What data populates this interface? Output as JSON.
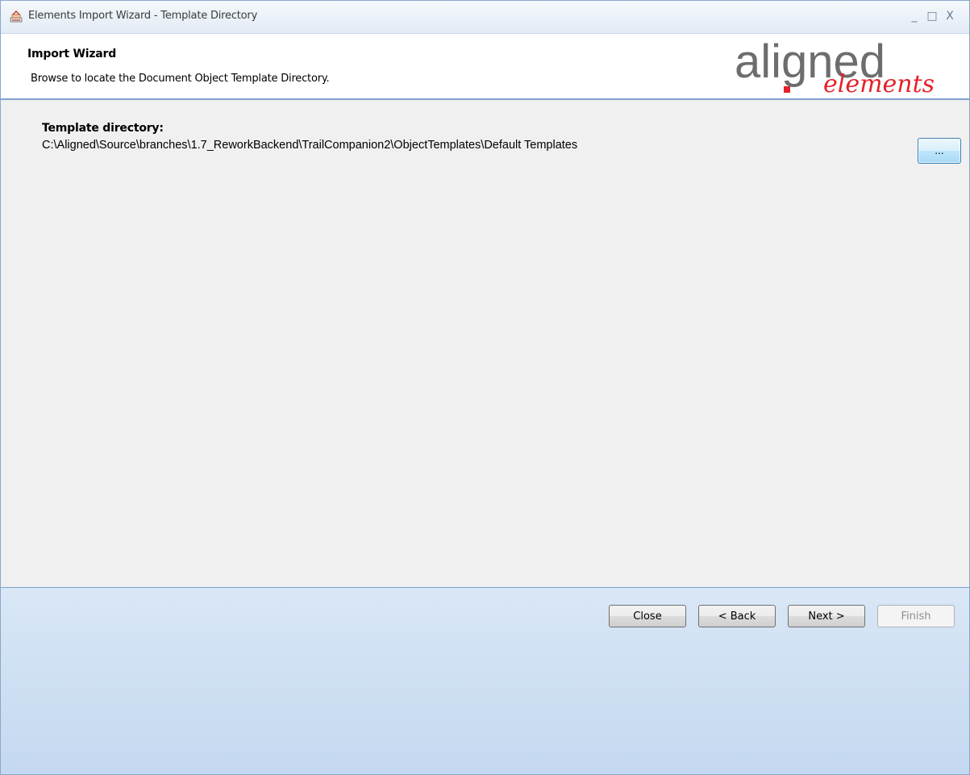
{
  "window": {
    "title": "Elements Import Wizard - Template Directory",
    "controls": {
      "minimize": "_",
      "maximize": "□",
      "close": "X"
    }
  },
  "header": {
    "title": "Import Wizard",
    "subtitle": "Browse to locate the Document Object Template Directory.",
    "logo": {
      "main_text": "aligned",
      "script_text": "elements",
      "colors": {
        "main": "#6d6d6d",
        "accent": "#e3232a"
      }
    }
  },
  "content": {
    "field_label": "Template directory:",
    "field_value": "C:\\Aligned\\Source\\branches\\1.7_ReworkBackend\\TrailCompanion2\\ObjectTemplates\\Default Templates",
    "browse_label": "..."
  },
  "footer": {
    "close_label": "Close",
    "back_label": "< Back",
    "next_label": "Next >",
    "finish_label": "Finish",
    "finish_enabled": false
  },
  "colors": {
    "header_border": "#7ea2cf",
    "footer_gradient_top": "#d9e7f6",
    "footer_gradient_bottom": "#c4d8f0",
    "content_bg": "#f0f0f0"
  }
}
